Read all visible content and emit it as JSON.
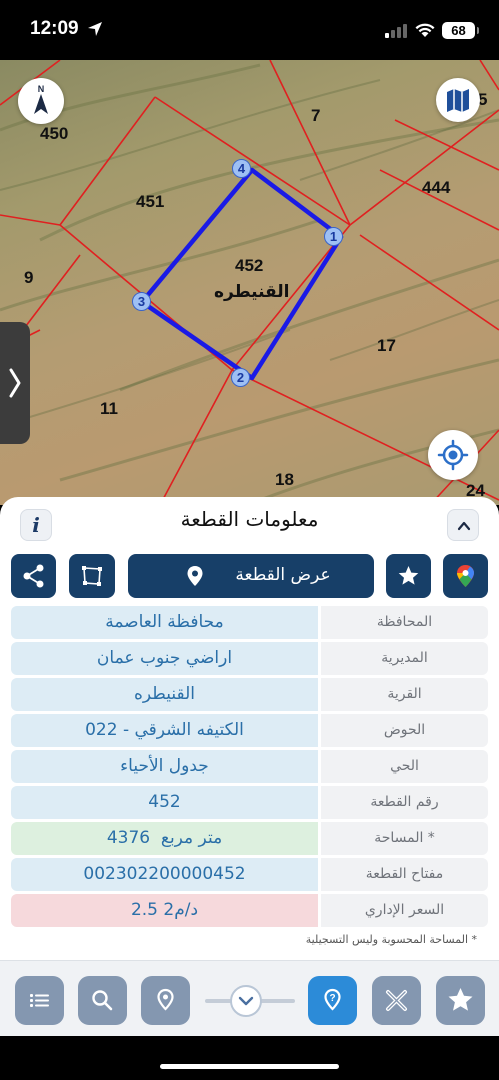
{
  "status_bar": {
    "time": "12:09",
    "battery": "68"
  },
  "map": {
    "parcels": [
      {
        "label": "450"
      },
      {
        "label": "7"
      },
      {
        "label": "5"
      },
      {
        "label": "451"
      },
      {
        "label": "444"
      },
      {
        "label": "9"
      },
      {
        "label": "17"
      },
      {
        "label": "11"
      },
      {
        "label": "18"
      },
      {
        "label": "24"
      }
    ],
    "selected_parcel": {
      "number": "452",
      "name": "القنيطره"
    },
    "vertices": [
      "1",
      "2",
      "3",
      "4"
    ],
    "highlight_color": "#1a1ae6",
    "boundary_color": "#e02020"
  },
  "panel": {
    "title": "معلومات القطعة",
    "info_icon": "i",
    "show_parcel_label": "عرض القطعة",
    "rows": [
      {
        "label": "المحافظة",
        "value": "محافظة العاصمة"
      },
      {
        "label": "المديرية",
        "value": "اراضي جنوب عمان"
      },
      {
        "label": "القرية",
        "value": "القنيطره"
      },
      {
        "label": "الحوض",
        "value": "الكتيفه الشرقي - 022"
      },
      {
        "label": "الحي",
        "value": "جدول الأحياء"
      },
      {
        "label": "رقم القطعة",
        "value": "452"
      },
      {
        "label": "المساحة *",
        "value": "4376  متر مربع"
      },
      {
        "label": "مفتاح القطعة",
        "value": "002302200000452"
      },
      {
        "label": "السعر الإداري",
        "value": "2.5 د/م2"
      }
    ],
    "footnote": "* المساحة المحسوبة وليس التسجيلية"
  },
  "toolbar": {
    "icons": [
      "list-icon",
      "search-icon",
      "location-pin-icon",
      "chevron-down-icon",
      "help-icon",
      "tools-icon",
      "star-icon"
    ]
  },
  "colors": {
    "primary_dark": "#173f68",
    "toolbar_button": "#8497b0",
    "active_button": "#2c8bd8",
    "value_bg": "#ddecf5",
    "area_bg": "#ddf0df",
    "price_bg": "#f6d9dc"
  }
}
